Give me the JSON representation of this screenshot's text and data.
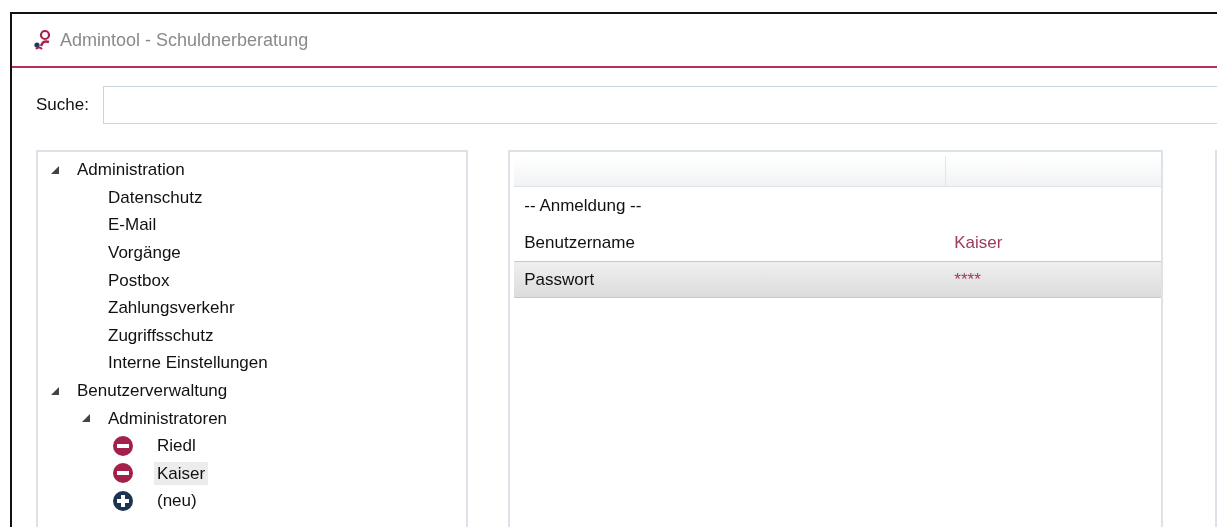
{
  "window": {
    "title": "Admintool - Schuldnerberatung"
  },
  "search": {
    "label": "Suche:"
  },
  "tree": [
    {
      "label": "Administration",
      "expanded": true,
      "children": [
        {
          "label": "Datenschutz",
          "selected": false
        },
        {
          "label": "E-Mail",
          "selected": false
        },
        {
          "label": "Vorgänge",
          "selected": false
        },
        {
          "label": "Postbox",
          "selected": false
        },
        {
          "label": "Zahlungsverkehr",
          "selected": false
        },
        {
          "label": "Zugriffsschutz",
          "selected": false
        },
        {
          "label": "Interne Einstellungen",
          "selected": false
        }
      ]
    },
    {
      "label": "Benutzerverwaltung",
      "expanded": true,
      "children": [
        {
          "label": "Administratoren",
          "expanded": true,
          "children": [
            {
              "label": "Riedl",
              "kind": "remove",
              "selected": false
            },
            {
              "label": "Kaiser",
              "kind": "remove",
              "selected": true
            },
            {
              "label": "(neu)",
              "kind": "add",
              "selected": false
            }
          ]
        }
      ]
    }
  ],
  "properties": {
    "rows": [
      {
        "kind": "section",
        "name": "-- Anmeldung --",
        "selected": false
      },
      {
        "kind": "value",
        "name": "Benutzername",
        "value": "Kaiser",
        "selected": false
      },
      {
        "kind": "value",
        "name": "Passwort",
        "value": "****",
        "selected": true
      }
    ]
  }
}
